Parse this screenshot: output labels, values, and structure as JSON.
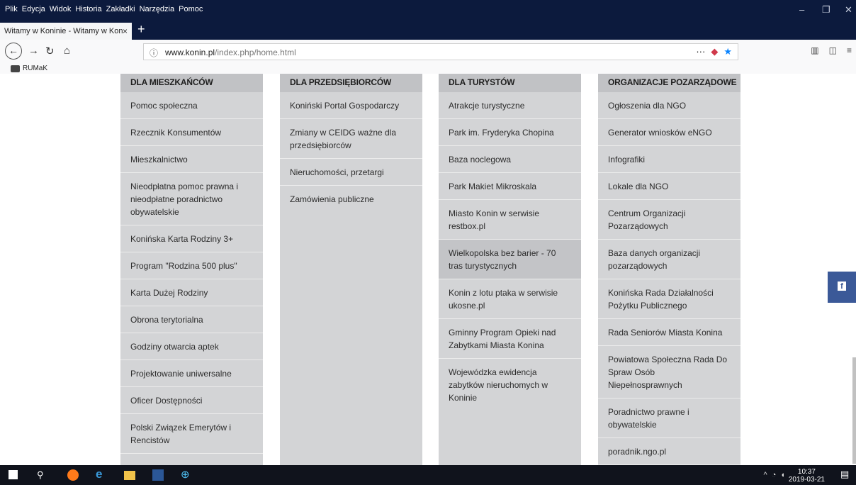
{
  "menubar": {
    "items": [
      "Plik",
      "Edycja",
      "Widok",
      "Historia",
      "Zakładki",
      "Narzędzia",
      "Pomoc"
    ]
  },
  "tab": {
    "title": "Witamy w Koninie - Witamy w Kon",
    "close": "×",
    "new_tab": "+"
  },
  "nav": {
    "url_host": "www.konin.pl",
    "url_path": "/index.php/home.html",
    "page_actions": "···"
  },
  "bookmarks": {
    "items": [
      "RUMaK"
    ]
  },
  "columns": [
    {
      "heading": "DLA MIESZKAŃCÓW",
      "items": [
        "Pomoc społeczna",
        "Rzecznik Konsumentów",
        "Mieszkalnictwo",
        "Nieodpłatna pomoc prawna i nieodpłatne poradnictwo obywatelskie",
        "Konińska Karta Rodziny 3+",
        "Program \"Rodzina 500 plus\"",
        "Karta Dużej Rodziny",
        "Obrona terytorialna",
        "Godziny otwarcia aptek",
        "Projektowanie uniwersalne",
        "Oficer Dostępności",
        "Polski Związek Emerytów i Rencistów"
      ]
    },
    {
      "heading": "DLA PRZEDSIĘBIORCÓW",
      "items": [
        "Koniński Portal Gospodarczy",
        "Zmiany w CEIDG ważne dla przedsiębiorców",
        "Nieruchomości, przetargi",
        "Zamówienia publiczne"
      ]
    },
    {
      "heading": "DLA TURYSTÓW",
      "items": [
        "Atrakcje turystyczne",
        "Park im. Fryderyka Chopina",
        "Baza noclegowa",
        "Park Makiet Mikroskala",
        "Miasto Konin w serwisie restbox.pl",
        "Wielkopolska bez barier - 70 tras turystycznych",
        "Konin z lotu ptaka w serwisie ukosne.pl",
        "Gminny Program Opieki nad Zabytkami Miasta Konina",
        "Wojewódzka ewidencja zabytków nieruchomych w Koninie"
      ]
    },
    {
      "heading": "ORGANIZACJE POZARZĄDOWE",
      "items": [
        "Ogłoszenia dla NGO",
        "Generator wniosków eNGO",
        "Infografiki",
        "Lokale dla NGO",
        "Centrum Organizacji Pozarządowych",
        "Baza danych organizacji pozarządowych",
        "Konińska Rada Działalności Pożytku Publicznego",
        "Rada Seniorów Miasta Konina",
        "Powiatowa Społeczna Rada Do Spraw Osób Niepełnosprawnych",
        "Poradnictwo prawne i obywatelskie",
        "poradnik.ngo.pl"
      ]
    }
  ],
  "facebook": {
    "label": "f",
    "icon": "facebook-icon",
    "color": "#3b5998"
  },
  "taskbar": {
    "time": "10:37",
    "date": "2019-03-21"
  }
}
